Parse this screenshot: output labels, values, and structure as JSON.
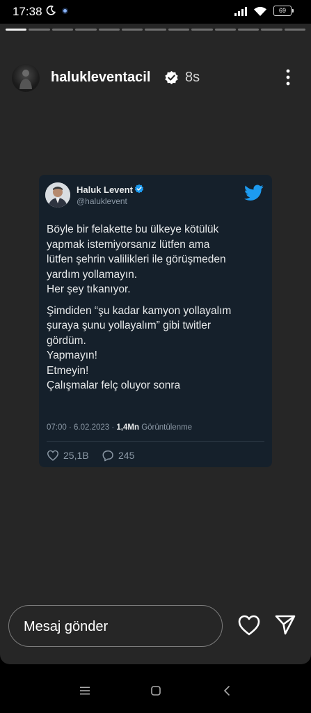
{
  "status_bar": {
    "time": "17:38",
    "battery": "69"
  },
  "story": {
    "progress": {
      "total_segments": 13,
      "viewed_segments": 1
    },
    "username": "halukleventacil",
    "time_ago": "8s"
  },
  "tweet": {
    "author_name": "Haluk Levent",
    "handle": "@haluklevent",
    "paragraph_1": [
      "Böyle bir felakette bu ülkeye kötülük",
      "yapmak istemiyorsanız lütfen ama",
      "lütfen şehrin valilikleri ile görüşmeden",
      "yardım yollamayın.",
      "Her şey tıkanıyor."
    ],
    "paragraph_2": [
      "Şimdiden “şu kadar kamyon yollayalım",
      "şuraya şunu yollayalım” gibi twitler",
      "gördüm.",
      "Yapmayın!",
      "Etmeyin!",
      "Çalışmalar felç oluyor sonra"
    ],
    "datetime": "07:00 · 6.02.2023 ·",
    "views_count": "1,4Mn",
    "views_label": "Görüntülenme",
    "likes": "25,1B",
    "replies": "245",
    "colors": {
      "background": "#15202b",
      "accent": "#1d9bf0"
    }
  },
  "composer": {
    "placeholder": "Mesaj gönder"
  },
  "icons": {
    "moon": "moon-icon",
    "signal": "signal-icon",
    "wifi": "wifi-icon",
    "verified": "verified-badge-icon",
    "more": "more-vertical-icon",
    "twitter": "twitter-bird-icon",
    "heart": "heart-icon",
    "reply": "reply-icon",
    "send": "send-icon",
    "nav_menu": "recents-icon",
    "nav_home": "home-icon",
    "nav_back": "back-icon"
  }
}
